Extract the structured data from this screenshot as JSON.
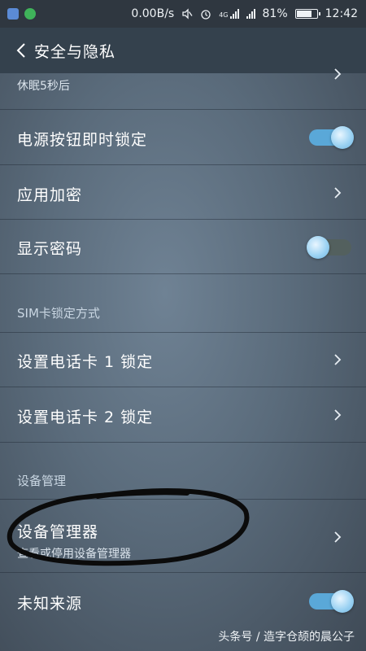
{
  "status_bar": {
    "speed": "0.00B/s",
    "network": "4G",
    "battery": "81%",
    "battery_level": 0.81,
    "time": "12:42",
    "left_icons": [
      "gallery-notification-icon",
      "app-notification-icon"
    ],
    "right_icons": [
      "mute-icon",
      "alarm-icon",
      "signal-icon",
      "signal-icon",
      "battery-icon"
    ]
  },
  "header": {
    "title": "安全与隐私",
    "back_icon": "chevron-left-icon"
  },
  "items": {
    "sleep_sub": "休眠5秒后",
    "power_lock": {
      "label": "电源按钮即时锁定",
      "toggle_on": true
    },
    "app_encrypt": {
      "label": "应用加密"
    },
    "show_password": {
      "label": "显示密码",
      "toggle_on": false
    },
    "sim_section": "SIM卡锁定方式",
    "sim1": {
      "label": "设置电话卡 1 锁定"
    },
    "sim2": {
      "label": "设置电话卡 2 锁定"
    },
    "device_section": "设备管理",
    "device_admin": {
      "label": "设备管理器",
      "sub": "查看或停用设备管理器"
    },
    "unknown_sources": {
      "label": "未知来源",
      "toggle_on": true
    }
  },
  "watermark": "头条号 / 造字仓颉的晨公子",
  "colors": {
    "accent": "#5aa8d8",
    "header": "#34414d",
    "statusbar": "#2f3740"
  }
}
